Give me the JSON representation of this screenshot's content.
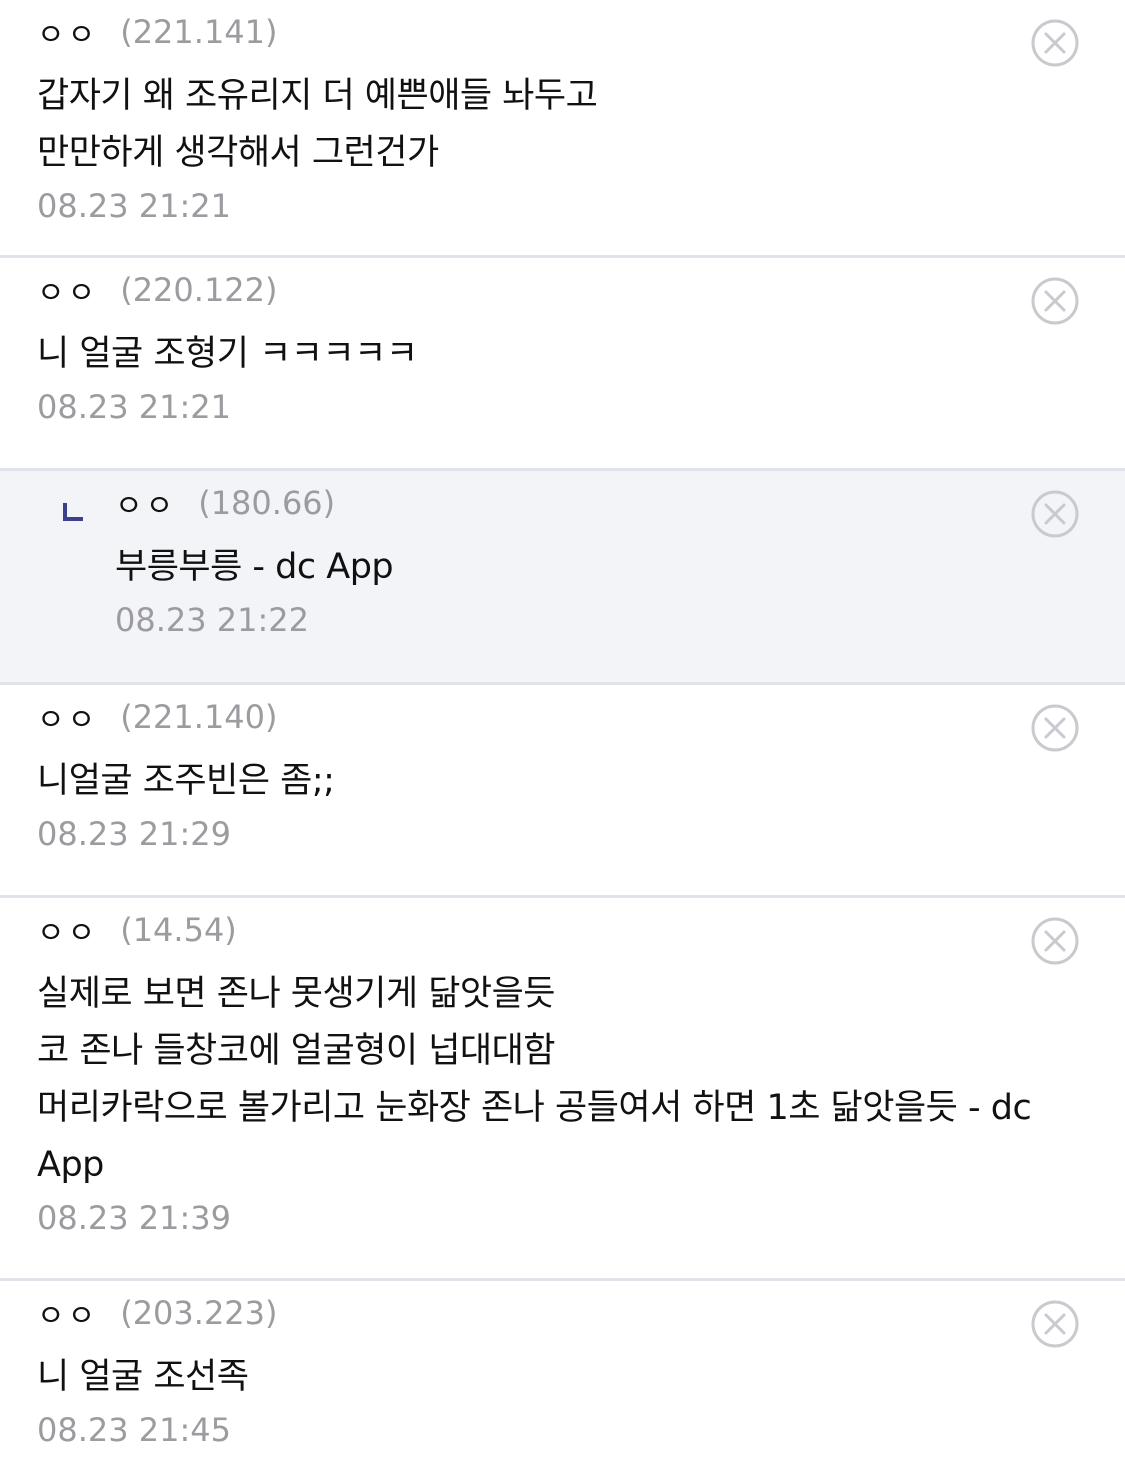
{
  "comments": [
    {
      "nick": "ㅇㅇ",
      "ip": "(221.141)",
      "body": "갑자기 왜 조유리지 더 예쁜애들 놔두고\n만만하게 생각해서 그런건가",
      "date": "08.23 21:21",
      "reply": false
    },
    {
      "nick": "ㅇㅇ",
      "ip": "(220.122)",
      "body": "니 얼굴 조형기 ㅋㅋㅋㅋㅋ",
      "date": "08.23 21:21",
      "reply": false
    },
    {
      "nick": "ㅇㅇ",
      "ip": "(180.66)",
      "body": "부릉부릉 - dc App",
      "date": "08.23 21:22",
      "reply": true
    },
    {
      "nick": "ㅇㅇ",
      "ip": "(221.140)",
      "body": "니얼굴 조주빈은 좀;;",
      "date": "08.23 21:29",
      "reply": false
    },
    {
      "nick": "ㅇㅇ",
      "ip": "(14.54)",
      "body": "실제로 보면 존나 못생기게 닮앗을듯\n코 존나 들창코에 얼굴형이 넙대대함\n머리카락으로 볼가리고 눈화장 존나 공들여서 하면 1초 닮앗을듯 - dc App",
      "date": "08.23 21:39",
      "reply": false
    },
    {
      "nick": "ㅇㅇ",
      "ip": "(203.223)",
      "body": "니 얼굴 조선족",
      "date": "08.23 21:45",
      "reply": false
    }
  ],
  "icons": {
    "delete": "close-circle-icon",
    "reply": "reply-arrow-icon"
  },
  "colors": {
    "reply_background": "#f3f4f8",
    "reply_mark": "#3b3f8c",
    "divider": "#e1e2ea",
    "meta_text": "#9b9ba0",
    "icon": "#c9c9cf"
  }
}
